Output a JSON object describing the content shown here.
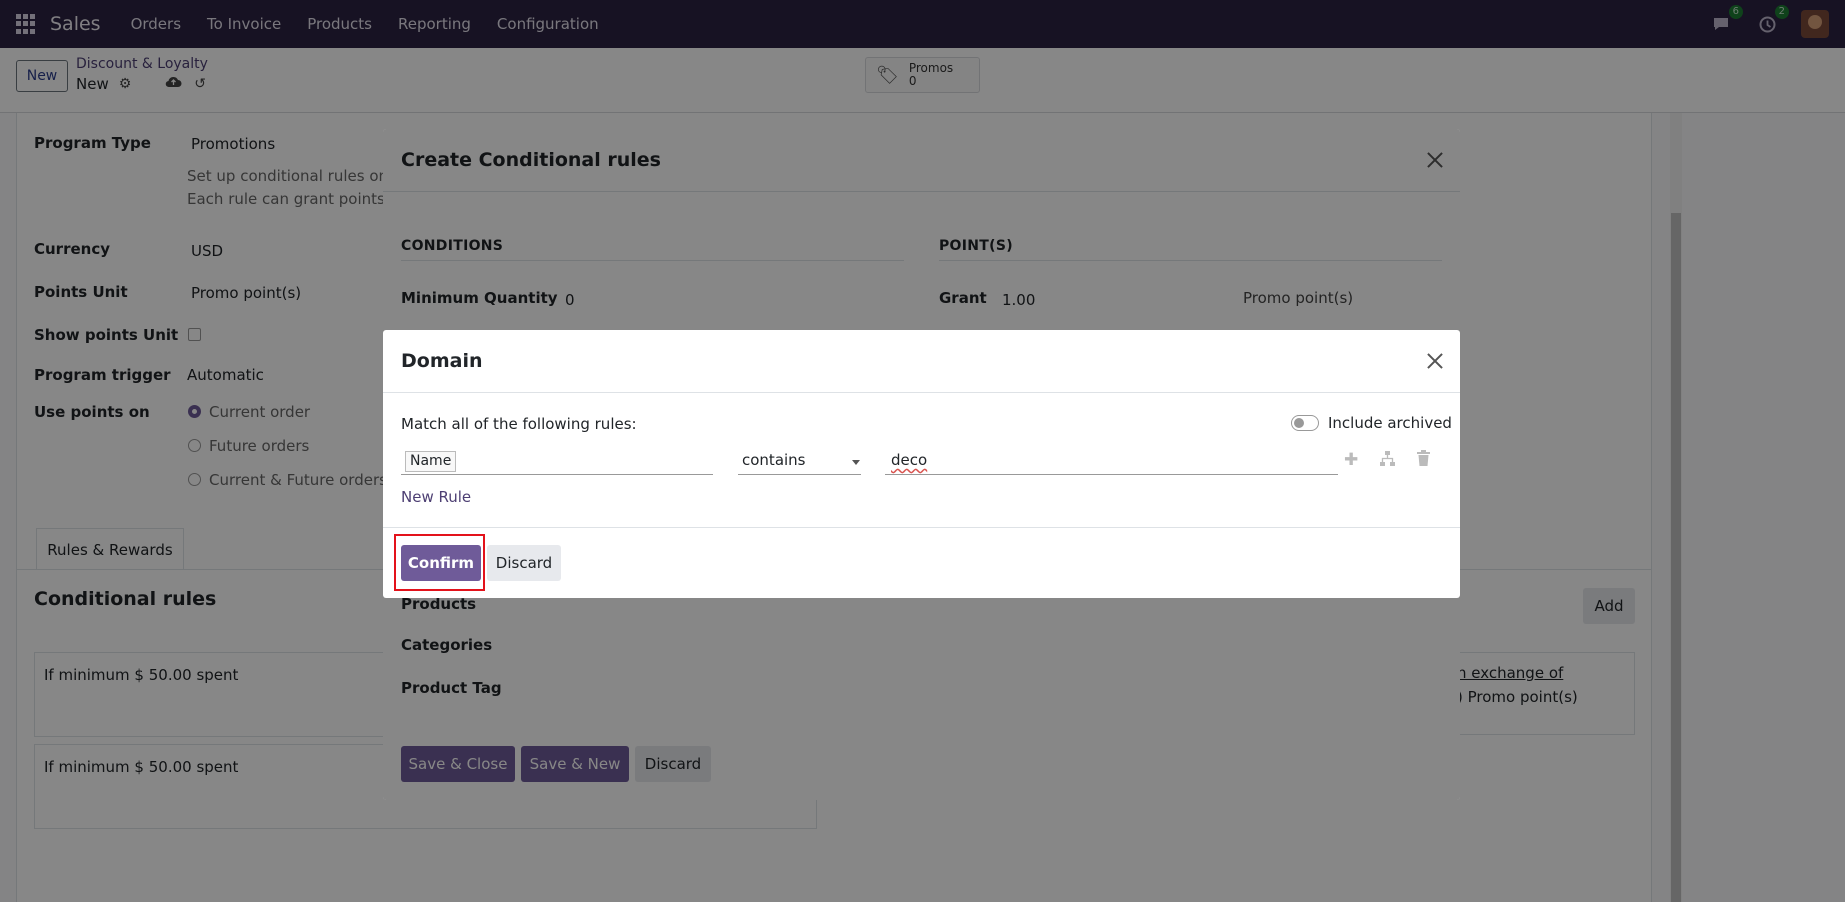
{
  "navbar": {
    "brand": "Sales",
    "items": [
      "Orders",
      "To Invoice",
      "Products",
      "Reporting",
      "Configuration"
    ],
    "messages_badge": "6",
    "activities_badge": "2"
  },
  "control": {
    "new_label": "New",
    "breadcrumb": "Discount & Loyalty",
    "record": "New",
    "stat": {
      "label": "Promos",
      "value": "0"
    }
  },
  "form": {
    "program_type_label": "Program Type",
    "program_type_value": "Promotions",
    "help_line1": "Set up conditional rules on t",
    "help_line2": "Each rule can grant points to",
    "currency_label": "Currency",
    "currency_value": "USD",
    "points_unit_label": "Points Unit",
    "points_unit_value": "Promo point(s)",
    "show_points_unit_label": "Show points Unit",
    "program_trigger_label": "Program trigger",
    "program_trigger_value": "Automatic",
    "use_points_on_label": "Use points on",
    "use_points_options": [
      "Current order",
      "Future orders",
      "Current & Future orders"
    ],
    "tab_label": "Rules & Rewards",
    "conditional_rules_title": "Conditional rules",
    "add_label": "Add",
    "rule1": "If minimum $ 50.00 spent",
    "rule2": "If minimum $ 50.00 spent",
    "reward_link": "n exchange of",
    "reward_points": ") Promo point(s)"
  },
  "modal_rules": {
    "title": "Create Conditional rules",
    "conditions_label": "CONDITIONS",
    "points_label": "POINT(S)",
    "min_qty_label": "Minimum Quantity",
    "min_qty_value": "0",
    "grant_label": "Grant",
    "grant_value": "1.00",
    "grant_unit": "Promo point(s)",
    "products_label": "Products",
    "categories_label": "Categories",
    "product_tag_label": "Product Tag",
    "save_close": "Save & Close",
    "save_new": "Save & New",
    "discard": "Discard"
  },
  "modal_domain": {
    "title": "Domain",
    "match_text": "Match all of the following rules:",
    "include_archived": "Include archived",
    "field": "Name",
    "operator": "contains",
    "value": "deco",
    "new_rule": "New Rule",
    "confirm": "Confirm",
    "discard": "Discard"
  },
  "colors": {
    "navbar": "#2c2342",
    "primary": "#6f5b99",
    "highlight": "#e3121b"
  }
}
